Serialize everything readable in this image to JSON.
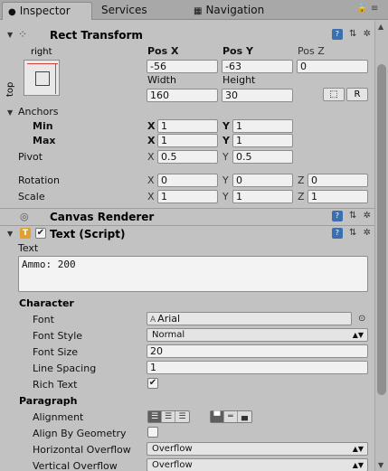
{
  "tabs": [
    {
      "label": "Inspector",
      "icon": "info-icon"
    },
    {
      "label": "Services",
      "icon": ""
    },
    {
      "label": "Navigation",
      "icon": "navigation-icon"
    }
  ],
  "rect_transform": {
    "title": "Rect Transform",
    "anchor_preset": {
      "h": "right",
      "v": "top"
    },
    "labels": {
      "pos_x": "Pos X",
      "pos_y": "Pos Y",
      "pos_z": "Pos Z",
      "width": "Width",
      "height": "Height"
    },
    "values": {
      "pos_x": "-56",
      "pos_y": "-63",
      "pos_z": "0",
      "width": "160",
      "height": "30"
    },
    "r_button": "R",
    "anchors": {
      "label": "Anchors",
      "min_label": "Min",
      "max_label": "Max",
      "min": {
        "x": "1",
        "y": "1"
      },
      "max": {
        "x": "1",
        "y": "1"
      }
    },
    "pivot": {
      "label": "Pivot",
      "x": "0.5",
      "y": "0.5"
    },
    "rotation": {
      "label": "Rotation",
      "x": "0",
      "y": "0",
      "z": "0"
    },
    "scale": {
      "label": "Scale",
      "x": "1",
      "y": "1",
      "z": "1"
    },
    "axis": {
      "x": "X",
      "y": "Y",
      "z": "Z"
    }
  },
  "canvas_renderer": {
    "title": "Canvas Renderer"
  },
  "text_script": {
    "title": "Text (Script)",
    "enabled": true,
    "text_label": "Text",
    "text_value": "Ammo: 200",
    "character_label": "Character",
    "font": {
      "label": "Font",
      "value": "Arial"
    },
    "font_style": {
      "label": "Font Style",
      "value": "Normal"
    },
    "font_size": {
      "label": "Font Size",
      "value": "20"
    },
    "line_spacing": {
      "label": "Line Spacing",
      "value": "1"
    },
    "rich_text": {
      "label": "Rich Text",
      "checked": true
    },
    "paragraph_label": "Paragraph",
    "alignment": {
      "label": "Alignment"
    },
    "align_by_geometry": {
      "label": "Align By Geometry",
      "checked": false
    },
    "horizontal_overflow": {
      "label": "Horizontal Overflow",
      "value": "Overflow"
    },
    "vertical_overflow": {
      "label": "Vertical Overflow",
      "value": "Overflow"
    }
  },
  "colors": {
    "panel_bg": "#c2c2c2",
    "field_bg": "#f0f0f0",
    "anchor_red": "#d04040"
  }
}
